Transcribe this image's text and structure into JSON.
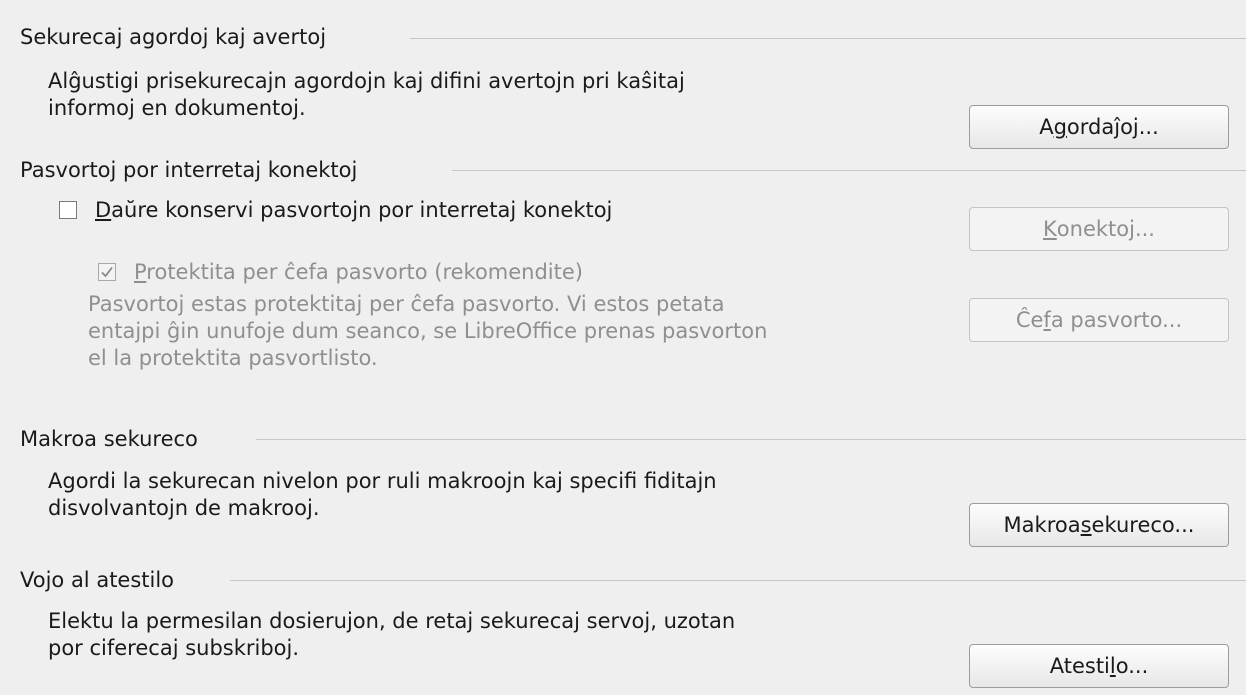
{
  "security_options": {
    "title": "Sekurecaj agordoj kaj avertoj",
    "description_line1": "Alĝustigi prisekurecajn agordojn kaj difini avertojn pri kaŝitaj",
    "description_line2": "informoj en dokumentoj.",
    "button": {
      "pre": "A",
      "key": "g",
      "post": "ordaĵoj..."
    }
  },
  "web_passwords": {
    "title": "Pasvortoj por interretaj konektoj",
    "persist_checkbox": {
      "key": "D",
      "post": "aŭre konservi pasvortojn por interretaj konektoj",
      "checked": false
    },
    "connections_button": {
      "key": "K",
      "post": "onektoj..."
    },
    "master_checkbox": {
      "key": "P",
      "post": "rotektita per ĉefa pasvorto (rekomendite)",
      "checked": true
    },
    "info_line1": "Pasvortoj estas protektitaj per ĉefa pasvorto. Vi estos petata",
    "info_line2": "entajpi ĝin unufoje dum seanco, se LibreOffice prenas pasvorton",
    "info_line3": "el la protektita pasvortlisto.",
    "master_button": {
      "pre": "Ĉe",
      "key": "f",
      "post": "a pasvorto..."
    }
  },
  "macro_security": {
    "title": "Makroa sekureco",
    "description_line1": "Agordi la sekurecan nivelon por ruli makroojn kaj specifi fiditajn",
    "description_line2": "disvolvantojn de makrooj.",
    "button": {
      "pre": "Makroa ",
      "key": "s",
      "post": "ekureco..."
    }
  },
  "certificate_path": {
    "title": "Vojo al atestilo",
    "description_line1": "Elektu la permesilan dosierujon, de retaj sekurecaj servoj, uzotan",
    "description_line2": "por ciferecaj subskriboj.",
    "button": {
      "pre": "Atesti",
      "key": "l",
      "post": "o..."
    }
  }
}
